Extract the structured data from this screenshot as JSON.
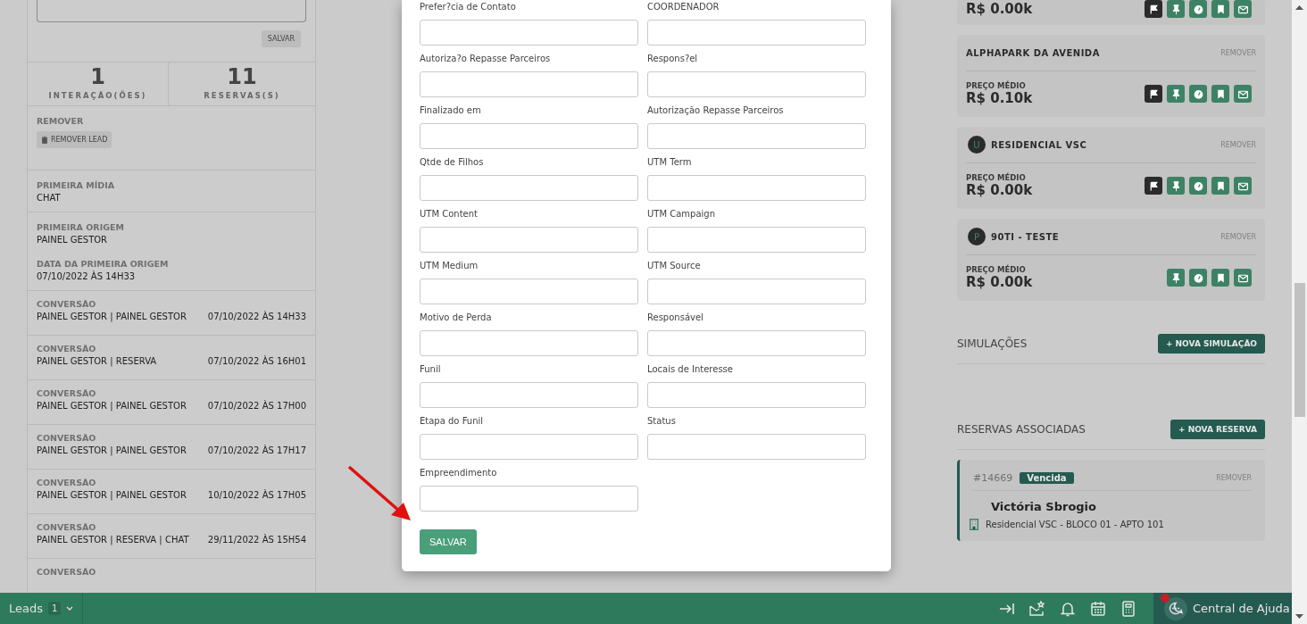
{
  "left_panel": {
    "save_button": "SALVAR",
    "stats": [
      {
        "value": "1",
        "label": "INTERAÇÃO(ÕES)"
      },
      {
        "value": "11",
        "label": "RESERVAS(S)"
      }
    ],
    "remove_section": {
      "title": "REMOVER",
      "button": "REMOVER LEAD"
    },
    "info_sections": [
      {
        "items": [
          {
            "label": "PRIMEIRA MÍDIA",
            "value": "CHAT"
          }
        ]
      },
      {
        "items": [
          {
            "label": "PRIMEIRA ORIGEM",
            "value": "PAINEL GESTOR"
          },
          {
            "label": "DATA DA PRIMEIRA ORIGEM",
            "value": "07/10/2022 ÀS 14H33"
          }
        ]
      }
    ],
    "conversions": [
      {
        "label": "CONVERSÃO",
        "value": "PAINEL GESTOR | PAINEL GESTOR",
        "date": "07/10/2022 ÀS 14H33"
      },
      {
        "label": "CONVERSÃO",
        "value": "PAINEL GESTOR | RESERVA",
        "date": "07/10/2022 ÀS 16H01"
      },
      {
        "label": "CONVERSÃO",
        "value": "PAINEL GESTOR | PAINEL GESTOR",
        "date": "07/10/2022 ÀS 17H00"
      },
      {
        "label": "CONVERSÃO",
        "value": "PAINEL GESTOR | PAINEL GESTOR",
        "date": "07/10/2022 ÀS 17H17"
      },
      {
        "label": "CONVERSÃO",
        "value": "PAINEL GESTOR | PAINEL GESTOR",
        "date": "10/10/2022 ÀS 17H05"
      },
      {
        "label": "CONVERSÃO",
        "value": "PAINEL GESTOR | RESERVA | CHAT",
        "date": "29/11/2022 ÀS 15H54"
      },
      {
        "label": "CONVERSÃO"
      }
    ]
  },
  "modal": {
    "fields": [
      {
        "label": "Prefer?cia de Contato"
      },
      {
        "label": "COORDENADOR"
      },
      {
        "label": "Autoriza?o Repasse Parceiros"
      },
      {
        "label": "Respons?el"
      },
      {
        "label": "Finalizado em"
      },
      {
        "label": "Autorização Repasse Parceiros"
      },
      {
        "label": "Qtde de Filhos"
      },
      {
        "label": "UTM Term"
      },
      {
        "label": "UTM Content"
      },
      {
        "label": "UTM Campaign"
      },
      {
        "label": "UTM Medium"
      },
      {
        "label": "UTM Source"
      },
      {
        "label": "Motivo de Perda"
      },
      {
        "label": "Responsável"
      },
      {
        "label": "Funil"
      },
      {
        "label": "Locais de Interesse"
      },
      {
        "label": "Etapa do Funil"
      },
      {
        "label": "Status"
      },
      {
        "label": "Empreendimento"
      }
    ],
    "submit": "SALVAR"
  },
  "right_panel": {
    "properties": [
      {
        "price": "R$ 0.00k",
        "actions": [
          {
            "kind": "flag"
          },
          {
            "kind": "pin"
          },
          {
            "kind": "gauge"
          },
          {
            "kind": "bookmark"
          },
          {
            "kind": "mail"
          }
        ]
      },
      {
        "name": "ALPHAPARK DA AVENIDA",
        "remove": "REMOVER",
        "price_label": "PREÇO MÉDIO",
        "price": "R$ 0.10k",
        "actions": [
          {
            "kind": "flag"
          },
          {
            "kind": "pin"
          },
          {
            "kind": "gauge"
          },
          {
            "kind": "bookmark"
          },
          {
            "kind": "mail"
          }
        ]
      },
      {
        "avatar": "U",
        "name": "RESIDENCIAL VSC",
        "remove": "REMOVER",
        "price_label": "PREÇO MÉDIO",
        "price": "R$ 0.00k",
        "actions": [
          {
            "kind": "flag"
          },
          {
            "kind": "pin"
          },
          {
            "kind": "gauge"
          },
          {
            "kind": "bookmark"
          },
          {
            "kind": "mail"
          }
        ]
      },
      {
        "avatar": "P",
        "name": "90TI - TESTE",
        "remove": "REMOVER",
        "price_label": "PREÇO MÉDIO",
        "price": "R$ 0.00k",
        "actions": [
          {
            "kind": "pin"
          },
          {
            "kind": "gauge"
          },
          {
            "kind": "bookmark"
          },
          {
            "kind": "mail"
          }
        ]
      }
    ],
    "simulations": {
      "title": "SIMULAÇÕES",
      "button": "+ NOVA SIMULAÇÃO"
    },
    "reservations": {
      "title": "RESERVAS ASSOCIADAS",
      "button": "+ NOVA RESERVA",
      "items": [
        {
          "id": "#14669",
          "status": "Vencida",
          "remove": "REMOVER",
          "name": "Victória Sbrogio",
          "unit": "Residencial VSC - BLOCO 01 - APTO 101"
        }
      ]
    }
  },
  "bottom_bar": {
    "leads_label": "Leads",
    "leads_count": "1",
    "help_label": "Central de Ajuda",
    "help_notification": true
  }
}
